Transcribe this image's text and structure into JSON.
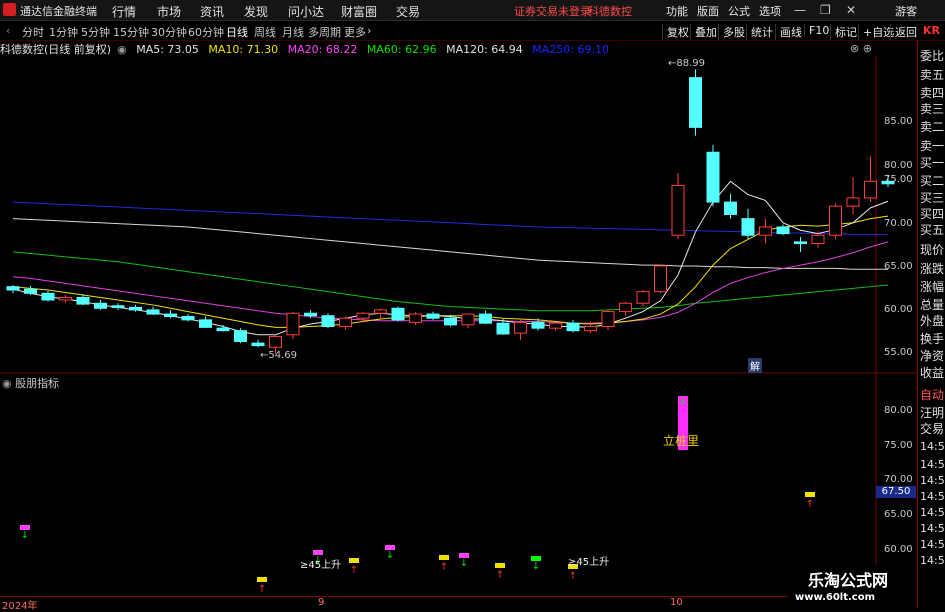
{
  "app_title": "通达信金融终端",
  "menu": [
    "行情",
    "市场",
    "资讯",
    "发现",
    "问小达",
    "财富圈",
    "交易"
  ],
  "status_warning": "证券交易未登录",
  "stock_name_header": "科德数控",
  "right_menu": [
    "功能",
    "版面",
    "公式",
    "选项"
  ],
  "guest_label": "游客",
  "periods": [
    "分时",
    "1分钟",
    "5分钟",
    "15分钟",
    "30分钟",
    "60分钟",
    "日线",
    "周线",
    "月线",
    "多周期",
    "更多"
  ],
  "active_period": "日线",
  "tools": [
    "复权",
    "叠加",
    "多股",
    "统计",
    "画线",
    "F10",
    "标记",
    "+自选",
    "返回"
  ],
  "kr_label": "KR",
  "chart_title": "科德数控(日线 前复权)",
  "ma": [
    {
      "label": "MA5: 73.05",
      "color": "#e0e0e0"
    },
    {
      "label": "MA10: 71.30",
      "color": "#f0e000"
    },
    {
      "label": "MA20: 68.22",
      "color": "#ff40ff"
    },
    {
      "label": "MA60: 62.96",
      "color": "#00e000"
    },
    {
      "label": "MA120: 64.94",
      "color": "#e0e0e0"
    },
    {
      "label": "MA250: 69.10",
      "color": "#2020ff"
    }
  ],
  "indicator_title": "股朋指标",
  "side_labels": [
    {
      "t": "委比",
      "c": ""
    },
    {
      "t": "卖五",
      "c": ""
    },
    {
      "t": "卖四",
      "c": ""
    },
    {
      "t": "卖三",
      "c": ""
    },
    {
      "t": "卖二",
      "c": ""
    },
    {
      "t": "卖一",
      "c": ""
    },
    {
      "t": "买一",
      "c": ""
    },
    {
      "t": "买二",
      "c": ""
    },
    {
      "t": "买三",
      "c": ""
    },
    {
      "t": "买四",
      "c": ""
    },
    {
      "t": "买五",
      "c": ""
    },
    {
      "t": "现价",
      "c": ""
    },
    {
      "t": "涨跌",
      "c": ""
    },
    {
      "t": "涨幅",
      "c": ""
    },
    {
      "t": "总量",
      "c": ""
    },
    {
      "t": "外盘",
      "c": ""
    },
    {
      "t": "换手",
      "c": ""
    },
    {
      "t": "净资",
      "c": ""
    },
    {
      "t": "收益",
      "c": ""
    },
    {
      "t": "自动",
      "c": "hi"
    },
    {
      "t": "汪明",
      "c": ""
    },
    {
      "t": "交易",
      "c": ""
    },
    {
      "t": "14:5",
      "c": ""
    },
    {
      "t": "14:5",
      "c": ""
    },
    {
      "t": "14:5",
      "c": ""
    },
    {
      "t": "14:5",
      "c": ""
    },
    {
      "t": "14:5",
      "c": ""
    },
    {
      "t": "14:5",
      "c": ""
    },
    {
      "t": "14:5",
      "c": ""
    },
    {
      "t": "14:5",
      "c": ""
    }
  ],
  "price_axis": [
    "85.00",
    "80.00",
    "75.00",
    "70.00",
    "65.00",
    "60.00",
    "55.00"
  ],
  "ind_axis": [
    "80.00",
    "75.00",
    "70.00",
    "65.00",
    "60.00"
  ],
  "ind_current": "67.50",
  "high_label": "88.99",
  "low_label": "54.69",
  "jie_label": "解",
  "li_label": "立桩里",
  "rise_labels": [
    "≥45上升",
    "≥45上升"
  ],
  "dates": [
    "2024年",
    "9",
    "10"
  ],
  "watermark": {
    "title": "乐淘公式网",
    "url": "www.60lt.com"
  },
  "chart_data": {
    "type": "candlestick",
    "ylim": [
      53,
      90
    ],
    "candles": [
      [
        62.8,
        63.0,
        62.0,
        62.4
      ],
      [
        62.5,
        62.9,
        61.8,
        62.0
      ],
      [
        62.0,
        62.3,
        61.0,
        61.2
      ],
      [
        61.2,
        61.8,
        60.8,
        61.5
      ],
      [
        61.5,
        61.9,
        60.6,
        60.7
      ],
      [
        60.8,
        61.2,
        60.0,
        60.2
      ],
      [
        60.5,
        60.8,
        60.0,
        60.3
      ],
      [
        60.3,
        60.6,
        59.8,
        60.0
      ],
      [
        60.0,
        60.4,
        59.4,
        59.5
      ],
      [
        59.5,
        60.0,
        59.0,
        59.2
      ],
      [
        59.2,
        59.5,
        58.6,
        58.8
      ],
      [
        58.8,
        59.2,
        57.8,
        57.9
      ],
      [
        57.8,
        58.2,
        57.4,
        57.5
      ],
      [
        57.5,
        57.8,
        56.0,
        56.2
      ],
      [
        56.0,
        56.4,
        55.5,
        55.7
      ],
      [
        55.5,
        57.0,
        54.7,
        56.8
      ],
      [
        57.0,
        59.8,
        56.5,
        59.6
      ],
      [
        59.6,
        60.0,
        59.0,
        59.3
      ],
      [
        59.3,
        59.6,
        57.8,
        58.0
      ],
      [
        58.0,
        59.2,
        57.6,
        59.0
      ],
      [
        59.0,
        59.8,
        58.5,
        59.6
      ],
      [
        59.6,
        60.2,
        59.0,
        60.0
      ],
      [
        60.2,
        60.4,
        58.6,
        58.8
      ],
      [
        58.5,
        59.7,
        58.2,
        59.5
      ],
      [
        59.5,
        59.8,
        58.8,
        59.0
      ],
      [
        59.0,
        59.4,
        58.0,
        58.2
      ],
      [
        58.2,
        59.6,
        57.8,
        59.5
      ],
      [
        59.5,
        59.9,
        58.3,
        58.4
      ],
      [
        58.4,
        58.9,
        57.0,
        57.1
      ],
      [
        57.2,
        58.8,
        56.4,
        58.5
      ],
      [
        58.5,
        59.0,
        57.5,
        57.8
      ],
      [
        57.8,
        58.5,
        57.5,
        58.4
      ],
      [
        58.4,
        58.8,
        57.3,
        57.5
      ],
      [
        57.5,
        58.6,
        57.2,
        58.0
      ],
      [
        58.0,
        60.0,
        57.6,
        59.8
      ],
      [
        59.8,
        61.0,
        59.3,
        60.8
      ],
      [
        60.8,
        62.4,
        60.4,
        62.2
      ],
      [
        62.2,
        65.5,
        62.0,
        65.3
      ],
      [
        69.0,
        76.5,
        68.5,
        75.0
      ],
      [
        88.0,
        88.99,
        81.0,
        82.0
      ],
      [
        79.0,
        79.9,
        72.5,
        73.0
      ],
      [
        73.0,
        74.0,
        71.0,
        71.5
      ],
      [
        71.0,
        72.2,
        68.5,
        69.0
      ],
      [
        69.0,
        71.0,
        68.0,
        70.0
      ],
      [
        70.0,
        70.3,
        69.0,
        69.2
      ],
      [
        68.2,
        68.8,
        67.0,
        68.0
      ],
      [
        68.0,
        69.5,
        67.5,
        69.0
      ],
      [
        69.0,
        72.8,
        68.5,
        72.5
      ],
      [
        72.5,
        76.0,
        71.5,
        73.5
      ],
      [
        73.5,
        78.5,
        73.0,
        75.5
      ],
      [
        75.5,
        76.3,
        74.8,
        75.2
      ]
    ],
    "ma5": [
      62.5,
      62.0,
      61.6,
      61.3,
      61.0,
      60.6,
      60.3,
      60.0,
      59.7,
      59.3,
      58.9,
      58.5,
      58.0,
      57.4,
      57.0,
      57.0,
      57.8,
      58.3,
      58.6,
      59.0,
      59.4,
      59.6,
      59.4,
      59.3,
      59.3,
      59.2,
      58.9,
      58.9,
      58.7,
      58.4,
      58.3,
      58.0,
      58.0,
      57.9,
      58.3,
      59.0,
      59.8,
      61.1,
      64.2,
      69.4,
      73.0,
      75.5,
      73.9,
      73.2,
      70.5,
      69.6,
      69.2,
      69.7,
      70.5,
      72.3,
      73.1
    ],
    "ma10": [
      62.8,
      62.6,
      62.4,
      62.1,
      61.8,
      61.5,
      61.2,
      60.9,
      60.6,
      60.2,
      59.8,
      59.4,
      59.0,
      58.6,
      58.2,
      57.9,
      57.9,
      58.0,
      58.1,
      58.3,
      58.6,
      58.9,
      59.1,
      59.2,
      59.3,
      59.3,
      59.3,
      59.2,
      59.0,
      58.9,
      58.8,
      58.6,
      58.4,
      58.3,
      58.4,
      58.6,
      58.9,
      59.5,
      60.7,
      62.8,
      65.4,
      67.4,
      68.5,
      69.6,
      70.0,
      70.2,
      70.1,
      70.3,
      70.5,
      71.0,
      71.3
    ],
    "ma20": [
      64.0,
      63.8,
      63.5,
      63.2,
      62.9,
      62.6,
      62.3,
      62.0,
      61.7,
      61.4,
      61.1,
      60.8,
      60.5,
      60.2,
      59.9,
      59.6,
      59.4,
      59.2,
      59.0,
      58.9,
      58.8,
      58.7,
      58.7,
      58.7,
      58.7,
      58.7,
      58.7,
      58.7,
      58.7,
      58.6,
      58.6,
      58.5,
      58.4,
      58.4,
      58.5,
      58.6,
      58.8,
      59.1,
      59.7,
      60.8,
      62.1,
      63.2,
      63.9,
      64.5,
      65.0,
      65.4,
      65.8,
      66.3,
      66.9,
      67.6,
      68.2
    ],
    "ma60": [
      67.0,
      66.8,
      66.6,
      66.4,
      66.2,
      66.0,
      65.8,
      65.5,
      65.2,
      64.9,
      64.6,
      64.3,
      64.0,
      63.7,
      63.4,
      63.1,
      62.8,
      62.5,
      62.2,
      61.9,
      61.6,
      61.3,
      61.0,
      60.8,
      60.6,
      60.4,
      60.3,
      60.2,
      60.1,
      60.0,
      59.9,
      59.9,
      59.9,
      59.9,
      60.0,
      60.1,
      60.2,
      60.3,
      60.5,
      60.8,
      61.0,
      61.2,
      61.4,
      61.6,
      61.8,
      62.0,
      62.2,
      62.4,
      62.6,
      62.8,
      63.0
    ],
    "ma120": [
      71.0,
      70.9,
      70.8,
      70.7,
      70.6,
      70.5,
      70.4,
      70.3,
      70.2,
      70.1,
      70.0,
      69.8,
      69.6,
      69.4,
      69.2,
      69.0,
      68.8,
      68.6,
      68.4,
      68.2,
      68.0,
      67.8,
      67.6,
      67.4,
      67.2,
      67.0,
      66.8,
      66.6,
      66.4,
      66.2,
      66.0,
      65.9,
      65.8,
      65.7,
      65.6,
      65.5,
      65.4,
      65.4,
      65.3,
      65.3,
      65.2,
      65.2,
      65.1,
      65.1,
      65.0,
      65.0,
      65.0,
      65.0,
      64.9,
      64.9,
      64.9
    ],
    "ma250": [
      73.0,
      72.9,
      72.8,
      72.7,
      72.6,
      72.5,
      72.4,
      72.3,
      72.2,
      72.1,
      72.0,
      71.9,
      71.8,
      71.7,
      71.6,
      71.5,
      71.4,
      71.3,
      71.2,
      71.1,
      71.0,
      70.9,
      70.8,
      70.7,
      70.6,
      70.5,
      70.4,
      70.3,
      70.2,
      70.1,
      70.0,
      69.95,
      69.9,
      69.85,
      69.8,
      69.75,
      69.7,
      69.65,
      69.6,
      69.55,
      69.5,
      69.45,
      69.4,
      69.35,
      69.3,
      69.25,
      69.2,
      69.15,
      69.1,
      69.1,
      69.1
    ]
  }
}
